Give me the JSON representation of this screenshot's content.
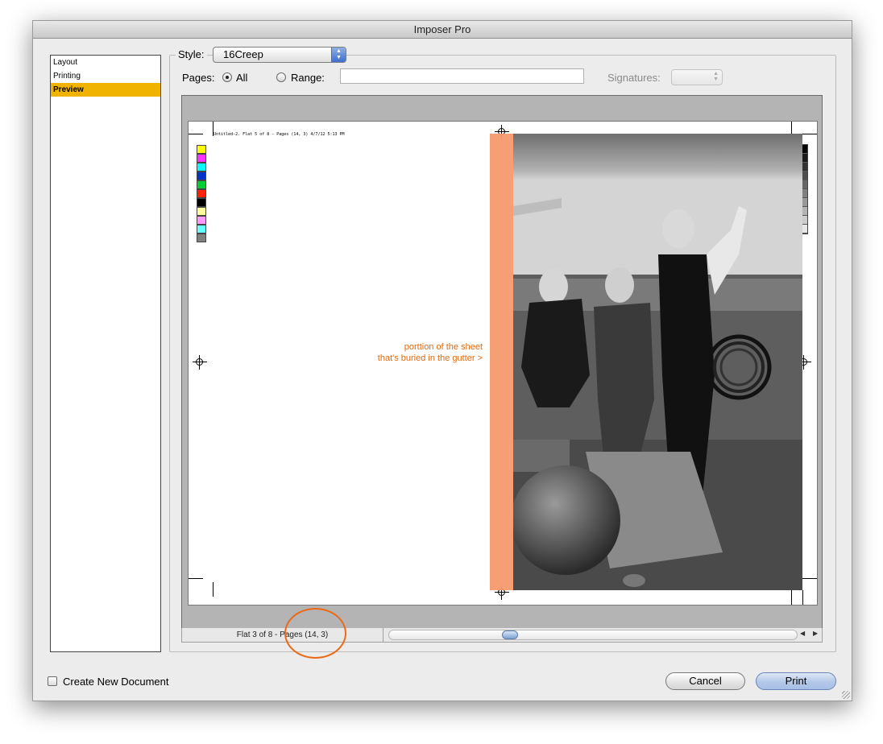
{
  "window": {
    "title": "Imposer Pro"
  },
  "sidebar": {
    "items": [
      {
        "label": "Layout",
        "selected": false
      },
      {
        "label": "Printing",
        "selected": false
      },
      {
        "label": "Preview",
        "selected": true
      }
    ]
  },
  "controls": {
    "style_label": "Style:",
    "style_value": "16Creep",
    "pages_label": "Pages:",
    "all_label": "All",
    "all_selected": true,
    "range_label": "Range:",
    "range_value": "",
    "signatures_label": "Signatures:",
    "signatures_value": ""
  },
  "preview": {
    "slug_text": "Untitled-2. Flat 5 of 8 - Pages (14, 3) 4/7/12 5:13 PM",
    "annotation_line1": "porttion of the sheet",
    "annotation_line2": "that's buried in the gutter >",
    "color_bar": [
      "#ffff00",
      "#ff33ff",
      "#00ffff",
      "#0033cc",
      "#00cc33",
      "#ff2200",
      "#000000",
      "#ffff99",
      "#ff99ff",
      "#66ffff",
      "#808080"
    ],
    "gray_bar": [
      "#000000",
      "#1a1a1a",
      "#333333",
      "#4d4d4d",
      "#666666",
      "#808080",
      "#999999",
      "#b3b3b3",
      "#cccccc",
      "#e6e6e6"
    ],
    "gutter_color": "#f59a6d",
    "annotation_color": "#e26a0e"
  },
  "status": {
    "text": "Flat 3 of 8 - Pages (14, 3)"
  },
  "footer": {
    "create_new_document_label": "Create New Document",
    "create_new_document_checked": false,
    "cancel_label": "Cancel",
    "print_label": "Print"
  }
}
